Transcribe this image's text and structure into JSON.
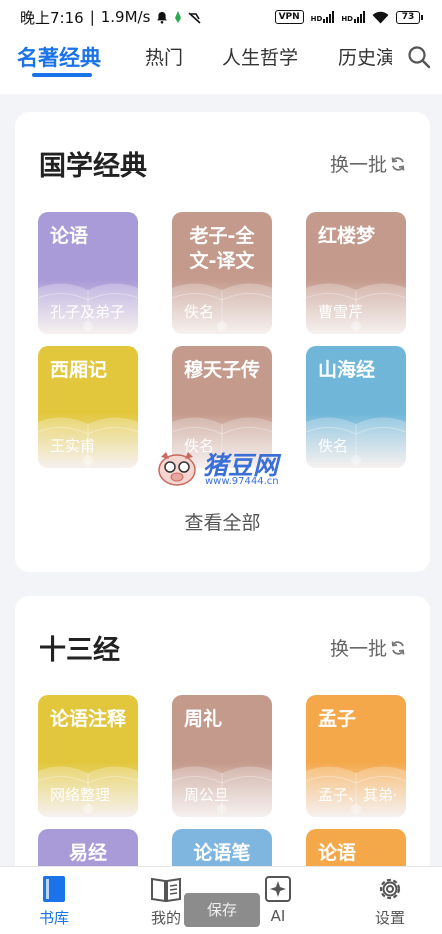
{
  "status_bar": {
    "time": "晚上7:16",
    "speed": "1.9M/s",
    "vpn": "VPN",
    "hd1": "HD",
    "hd2": "HD",
    "battery": "73"
  },
  "tabs": [
    {
      "label": "名著经典",
      "active": true
    },
    {
      "label": "热门",
      "active": false
    },
    {
      "label": "人生哲学",
      "active": false
    },
    {
      "label": "历史演",
      "active": false
    }
  ],
  "sections": [
    {
      "title": "国学经典",
      "refresh_label": "换一批",
      "view_all": "查看全部",
      "books": [
        {
          "title": "论语",
          "author": "孔子及弟子",
          "color": "#a99ad8"
        },
        {
          "title": "老子-全文-译文",
          "author": "佚名",
          "color": "#c49a8c"
        },
        {
          "title": "红楼梦",
          "author": "曹雪芹",
          "color": "#c49a8c"
        },
        {
          "title": "西厢记",
          "author": "王实甫",
          "color": "#e2c73c"
        },
        {
          "title": "穆天子传",
          "author": "佚名",
          "color": "#c49a8c"
        },
        {
          "title": "山海经",
          "author": "佚名",
          "color": "#6fb6d8"
        }
      ]
    },
    {
      "title": "十三经",
      "refresh_label": "换一批",
      "books": [
        {
          "title": "论语注释",
          "author": "网络整理",
          "color": "#e2c73c"
        },
        {
          "title": "周礼",
          "author": "周公旦",
          "color": "#c49a8c"
        },
        {
          "title": "孟子",
          "author": "孟子、其弟子",
          "color": "#f4a84a"
        },
        {
          "title": "易经",
          "author": "",
          "color": "#a99ad8"
        },
        {
          "title": "论语笔",
          "author": "",
          "color": "#7fb6e0"
        },
        {
          "title": "论语",
          "author": "",
          "color": "#f4a84a"
        }
      ]
    }
  ],
  "bottom_nav": [
    {
      "label": "书库",
      "icon": "book-icon",
      "active": true
    },
    {
      "label": "我的",
      "icon": "open-book-icon",
      "active": false
    },
    {
      "label": "AI",
      "icon": "ai-sparkle-icon",
      "active": false
    },
    {
      "label": "设置",
      "icon": "gear-icon",
      "active": false
    }
  ],
  "toast": "保存",
  "watermark": {
    "text": "猪豆网",
    "url": "www.97444.cn"
  },
  "colors": {
    "accent": "#1a73e8"
  }
}
